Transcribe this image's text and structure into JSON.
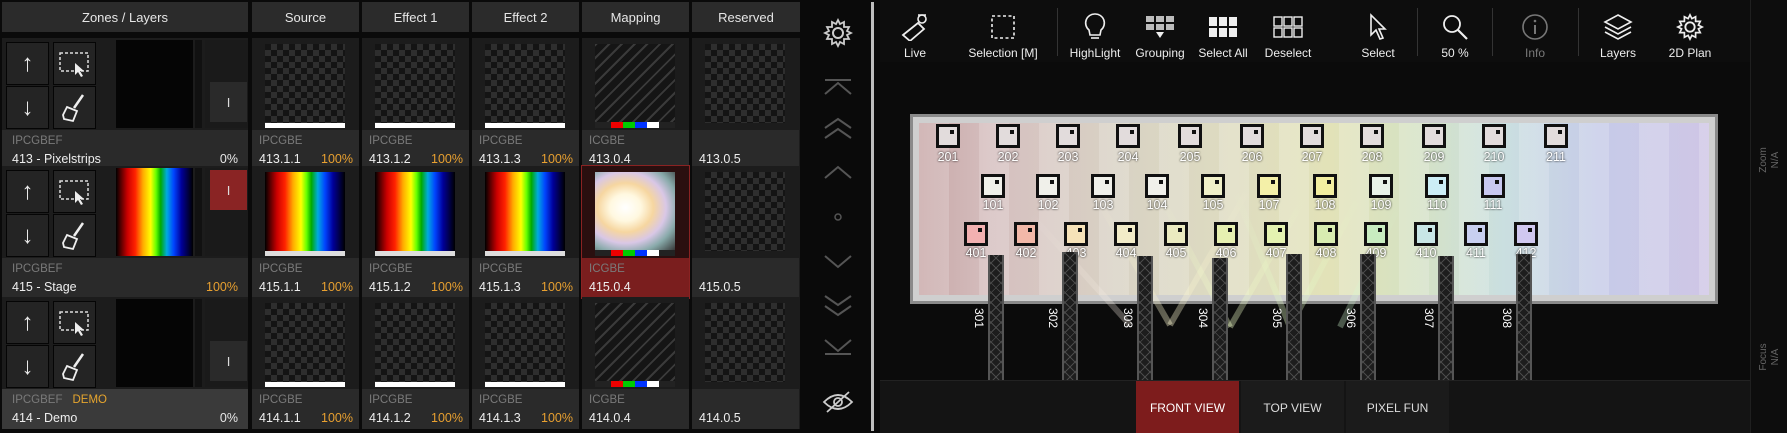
{
  "headers": {
    "zones": "Zones / Layers",
    "source": "Source",
    "effect1": "Effect 1",
    "effect2": "Effect 2",
    "mapping": "Mapping",
    "reserved": "Reserved"
  },
  "zones": [
    {
      "code": "IPCGBEF",
      "demo": "",
      "name": "413 - Pixelstrips",
      "pct": "0%",
      "indicator": "I"
    },
    {
      "code": "IPCGBEF",
      "demo": "",
      "name": "415 - Stage",
      "pct": "100%",
      "indicator": "I"
    },
    {
      "code": "IPCGBEF",
      "demo": "DEMO",
      "name": "414 - Demo",
      "pct": "0%",
      "indicator": "I"
    }
  ],
  "cells": [
    [
      {
        "code": "IPCGBE",
        "name": "413.1.1",
        "pct": "100%"
      },
      {
        "code": "IPCGBE",
        "name": "413.1.2",
        "pct": "100%"
      },
      {
        "code": "IPCGBE",
        "name": "413.1.3",
        "pct": "100%"
      },
      {
        "code": "ICGBE",
        "name": "413.0.4",
        "pct": ""
      },
      {
        "code": "",
        "name": "413.0.5",
        "pct": ""
      }
    ],
    [
      {
        "code": "IPCGBE",
        "name": "415.1.1",
        "pct": "100%"
      },
      {
        "code": "IPCGBE",
        "name": "415.1.2",
        "pct": "100%"
      },
      {
        "code": "IPCGBE",
        "name": "415.1.3",
        "pct": "100%"
      },
      {
        "code": "ICGBE",
        "name": "415.0.4",
        "pct": ""
      },
      {
        "code": "",
        "name": "415.0.5",
        "pct": ""
      }
    ],
    [
      {
        "code": "IPCGBE",
        "name": "414.1.1",
        "pct": "100%"
      },
      {
        "code": "IPCGBE",
        "name": "414.1.2",
        "pct": "100%"
      },
      {
        "code": "IPCGBE",
        "name": "414.1.3",
        "pct": "100%"
      },
      {
        "code": "ICGBE",
        "name": "414.0.4",
        "pct": ""
      },
      {
        "code": "",
        "name": "414.0.5",
        "pct": ""
      }
    ]
  ],
  "toolbar": {
    "live": "Live",
    "selection": "Selection [M]",
    "highlight": "HighLight",
    "grouping": "Grouping",
    "selectall": "Select All",
    "deselect": "Deselect",
    "select": "Select",
    "zoom": "50 %",
    "info": "Info",
    "layers": "Layers",
    "plan2d": "2D Plan"
  },
  "fixtures_row1": [
    "201",
    "202",
    "203",
    "204",
    "205",
    "206",
    "207",
    "208",
    "209",
    "210",
    "211"
  ],
  "fixtures_row2": [
    "101",
    "102",
    "103",
    "104",
    "105",
    "107",
    "108",
    "109",
    "110",
    "111"
  ],
  "fixtures_row3": [
    "401",
    "402",
    "403",
    "404",
    "405",
    "406",
    "407",
    "408",
    "409",
    "410",
    "411",
    "412"
  ],
  "towers": [
    "301",
    "302",
    "303",
    "304",
    "305",
    "306",
    "307",
    "308"
  ],
  "view_tabs": {
    "front": "FRONT VIEW",
    "top": "TOP VIEW",
    "pixel": "PIXEL FUN"
  },
  "side_strip": {
    "zoom": "Zoom",
    "zoom_val": "N/A",
    "focus": "Focus",
    "focus_val": "N/A"
  },
  "colors": {
    "accent": "#7d1c1c",
    "highlight_pct": "#e8a030"
  }
}
